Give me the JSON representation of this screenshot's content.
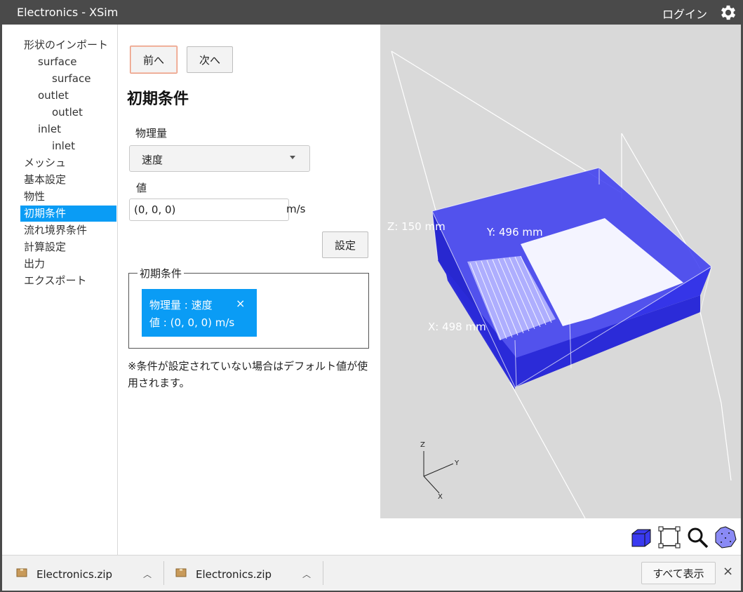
{
  "window": {
    "title": "Electronics - XSim",
    "login_label": "ログイン",
    "settings_icon": "gear-icon"
  },
  "nav": {
    "items": [
      {
        "label": "形状のインポート",
        "indent": 0
      },
      {
        "label": "surface",
        "indent": 1
      },
      {
        "label": "surface",
        "indent": 2
      },
      {
        "label": "outlet",
        "indent": 1
      },
      {
        "label": "outlet",
        "indent": 2
      },
      {
        "label": "inlet",
        "indent": 1
      },
      {
        "label": "inlet",
        "indent": 2
      },
      {
        "label": "メッシュ",
        "indent": 0
      },
      {
        "label": "基本設定",
        "indent": 0
      },
      {
        "label": "物性",
        "indent": 0
      },
      {
        "label": "初期条件",
        "indent": 0,
        "active": true
      },
      {
        "label": "流れ境界条件",
        "indent": 0
      },
      {
        "label": "計算設定",
        "indent": 0
      },
      {
        "label": "出力",
        "indent": 0
      },
      {
        "label": "エクスポート",
        "indent": 0
      }
    ]
  },
  "panel": {
    "prev_label": "前へ",
    "next_label": "次へ",
    "heading": "初期条件",
    "quantity_label": "物理量",
    "quantity_value": "速度",
    "value_label": "値",
    "value_input": "(0, 0, 0)",
    "unit": "m/s",
    "set_label": "設定",
    "group_legend": "初期条件",
    "chip": {
      "line1": "物理量 : 速度",
      "line2": "値 : (0, 0, 0) m/s",
      "close": "×"
    },
    "note": "※条件が設定されていない場合はデフォルト値が使用されます。"
  },
  "viewport": {
    "dim_z": "Z: 150 mm",
    "dim_y": "Y: 496 mm",
    "dim_x": "X: 498 mm",
    "axis_z": "Z",
    "axis_y": "Y",
    "axis_x": "X",
    "model_color": "#3333ff",
    "background": "#d9d9d9"
  },
  "toolbar": [
    "cube-view-icon",
    "fit-frame-icon",
    "zoom-icon",
    "mesh-sphere-icon"
  ],
  "downloads": {
    "items": [
      {
        "name": "Electronics.zip"
      },
      {
        "name": "Electronics.zip"
      }
    ],
    "show_all": "すべて表示",
    "close": "×"
  }
}
